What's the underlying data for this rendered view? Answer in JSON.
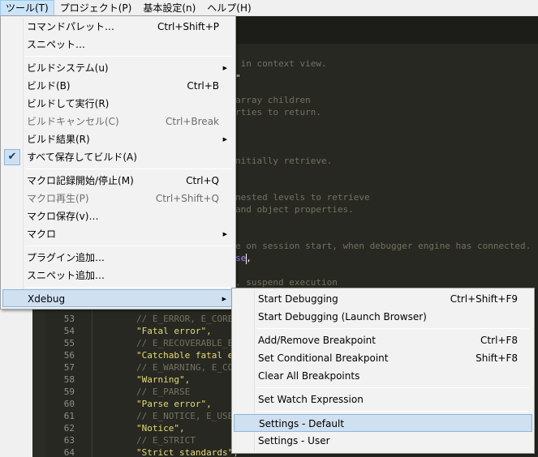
{
  "menubar": {
    "items": [
      {
        "label": "ツール(T)",
        "active": true
      },
      {
        "label": "プロジェクト(P)"
      },
      {
        "label": "基本設定(n)"
      },
      {
        "label": "ヘルプ(H)"
      }
    ]
  },
  "tools_menu": {
    "command_palette": {
      "label": "コマンドパレット…",
      "shortcut": "Ctrl+Shift+P"
    },
    "snippets": {
      "label": "スニペット…"
    },
    "build_system": {
      "label": "ビルドシステム(u)"
    },
    "build": {
      "label": "ビルド(B)",
      "shortcut": "Ctrl+B"
    },
    "build_run": {
      "label": "ビルドして実行(R)"
    },
    "build_cancel": {
      "label": "ビルドキャンセル(C)",
      "shortcut": "Ctrl+Break"
    },
    "build_results": {
      "label": "ビルド結果(R)"
    },
    "save_all_build": {
      "label": "すべて保存してビルド(A)",
      "checked": true
    },
    "record_macro": {
      "label": "マクロ記録開始/停止(M)",
      "shortcut": "Ctrl+Q"
    },
    "play_macro": {
      "label": "マクロ再生(P)",
      "shortcut": "Ctrl+Shift+Q"
    },
    "save_macro": {
      "label": "マクロ保存(v)…"
    },
    "macros": {
      "label": "マクロ"
    },
    "new_plugin": {
      "label": "プラグイン追加…"
    },
    "new_snippet": {
      "label": "スニペット追加…"
    },
    "xdebug": {
      "label": "Xdebug"
    }
  },
  "xdebug_menu": {
    "start_debugging": {
      "label": "Start Debugging",
      "shortcut": "Ctrl+Shift+F9"
    },
    "start_debugging_browser": {
      "label": "Start Debugging (Launch Browser)"
    },
    "add_remove_breakpoint": {
      "label": "Add/Remove Breakpoint",
      "shortcut": "Ctrl+F8"
    },
    "set_conditional_breakpoint": {
      "label": "Set Conditional Breakpoint",
      "shortcut": "Shift+F8"
    },
    "clear_all_breakpoints": {
      "label": "Clear All Breakpoints"
    },
    "set_watch_expression": {
      "label": "Set Watch Expression"
    },
    "settings_default": {
      "label": "Settings - Default"
    },
    "settings_user": {
      "label": "Settings - User"
    }
  },
  "editor": {
    "visible_fragments": [
      {
        "text": " in context view."
      },
      {
        "text": "\""
      },
      {
        "text": "array children"
      },
      {
        "text": "rties to return."
      },
      {
        "text": "nitially retrieve."
      },
      {
        "text": "nested levels to retrieve"
      },
      {
        "text": "and object properties."
      },
      {
        "text": "e on session start, when debugger engine has connected."
      },
      {
        "text_keyword": "se",
        "text_after": ","
      },
      {
        "text": ", suspend execution"
      }
    ],
    "lines": [
      {
        "number": "53",
        "code": "// E_ERROR, E_CORE_ERROR",
        "kind": "comment"
      },
      {
        "number": "54",
        "code": "\"Fatal error\",",
        "kind": "string"
      },
      {
        "number": "55",
        "code": "// E_RECOVERABLE_ERROR",
        "kind": "comment"
      },
      {
        "number": "56",
        "code": "\"Catchable fatal error\",",
        "kind": "string"
      },
      {
        "number": "57",
        "code": "// E_WARNING, E_CORE_WARNING",
        "kind": "comment"
      },
      {
        "number": "58",
        "code": "\"Warning\",",
        "kind": "string"
      },
      {
        "number": "59",
        "code": "// E_PARSE",
        "kind": "comment"
      },
      {
        "number": "60",
        "code": "\"Parse error\",",
        "kind": "string"
      },
      {
        "number": "61",
        "code": "// E_NOTICE, E_USER_NOTICE",
        "kind": "comment"
      },
      {
        "number": "62",
        "code": "\"Notice\",",
        "kind": "string"
      },
      {
        "number": "63",
        "code": "// E_STRICT",
        "kind": "comment"
      },
      {
        "number": "64",
        "code": "\"Strict standards\",",
        "kind": "string"
      }
    ]
  }
}
